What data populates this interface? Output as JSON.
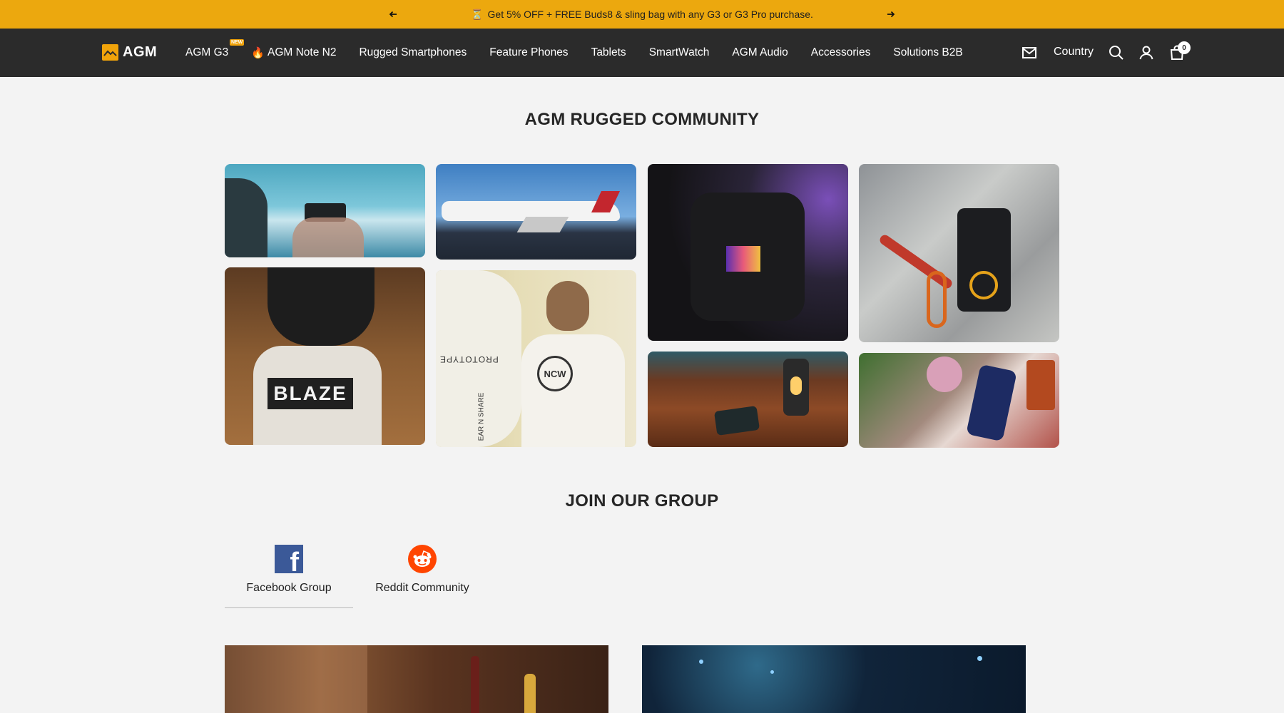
{
  "announcement": {
    "icon": "hourglass-icon",
    "text": "Get 5% OFF + FREE Buds8 & sling bag with any G3 or G3 Pro purchase."
  },
  "header": {
    "logo_text": "AGM",
    "nav": [
      {
        "label": "AGM G3",
        "badge": "NEW"
      },
      {
        "label": "AGM Note N2",
        "icon": "fire-icon"
      },
      {
        "label": "Rugged Smartphones"
      },
      {
        "label": "Feature Phones"
      },
      {
        "label": "Tablets"
      },
      {
        "label": "SmartWatch"
      },
      {
        "label": "AGM Audio"
      },
      {
        "label": "Accessories"
      },
      {
        "label": "Solutions B2B"
      }
    ],
    "country_label": "Country",
    "cart_count": "0"
  },
  "community": {
    "title": "AGM RUGGED COMMUNITY",
    "photo_text": {
      "shirt_print": "BLAZE",
      "surfboard_print": "PROTOTYPE",
      "board_print": "EAR N SHARE",
      "badge_text": "NCW"
    }
  },
  "join": {
    "title": "JOIN OUR GROUP",
    "links": [
      {
        "label": "Facebook Group",
        "icon": "facebook-icon"
      },
      {
        "label": "Reddit Community",
        "icon": "reddit-icon"
      }
    ]
  },
  "colors": {
    "accent": "#eca80e",
    "header_bg": "#2b2b2b",
    "page_bg": "#f3f3f3"
  }
}
